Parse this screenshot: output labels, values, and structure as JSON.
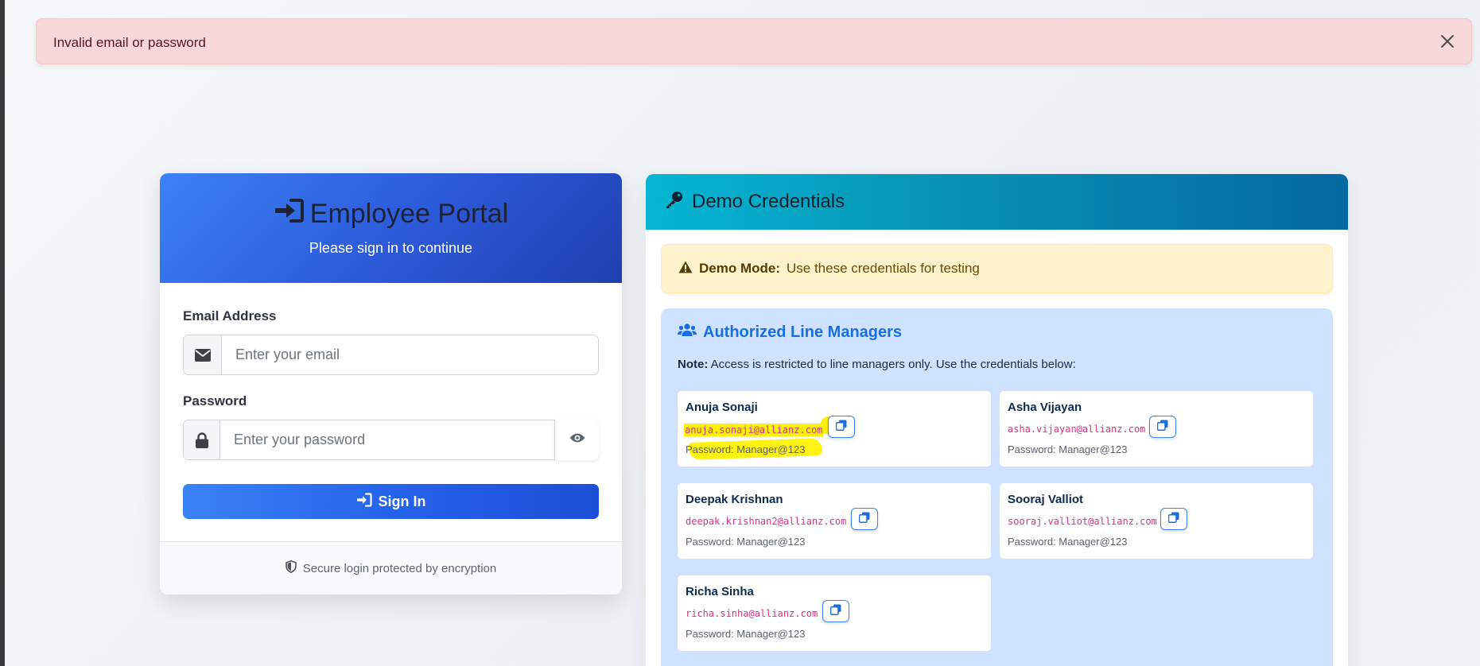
{
  "alert": {
    "message": "Invalid email or password"
  },
  "login": {
    "title": "Employee Portal",
    "subtitle": "Please sign in to continue",
    "email_label": "Email Address",
    "email_placeholder": "Enter your email",
    "password_label": "Password",
    "password_placeholder": "Enter your password",
    "signin_label": "Sign In",
    "footer_text": "Secure login protected by encryption"
  },
  "demo": {
    "title": "Demo Credentials",
    "mode_label": "Demo Mode:",
    "mode_text": "Use these credentials for testing",
    "managers_title": "Authorized Line Managers",
    "note_label": "Note:",
    "note_text": "Access is restricted to line managers only. Use the credentials below:",
    "credentials": [
      {
        "name": "Anuja Sonaji",
        "email": "anuja.sonaji@allianz.com",
        "password": "Password: Manager@123"
      },
      {
        "name": "Asha Vijayan",
        "email": "asha.vijayan@allianz.com",
        "password": "Password: Manager@123"
      },
      {
        "name": "Deepak Krishnan",
        "email": "deepak.krishnan2@allianz.com",
        "password": "Password: Manager@123"
      },
      {
        "name": "Sooraj Valliot",
        "email": "sooraj.valliot@allianz.com",
        "password": "Password: Manager@123"
      },
      {
        "name": "Richa Sinha",
        "email": "richa.sinha@allianz.com",
        "password": "Password: Manager@123"
      }
    ]
  },
  "colors": {
    "alert_bg": "#f8d7da",
    "primary": "#2563eb",
    "info": "#0891b2",
    "warning_bg": "#fff3cd",
    "managers_bg": "#cfe2ff",
    "email_text": "#d63384",
    "highlight": "#fff200"
  },
  "icons": {
    "close": "close-icon",
    "signin": "sign-in-icon",
    "envelope": "envelope-icon",
    "lock": "lock-icon",
    "eye": "eye-icon",
    "shield": "shield-icon",
    "key": "key-icon",
    "warning": "warning-icon",
    "users": "users-icon",
    "copy": "copy-icon"
  }
}
